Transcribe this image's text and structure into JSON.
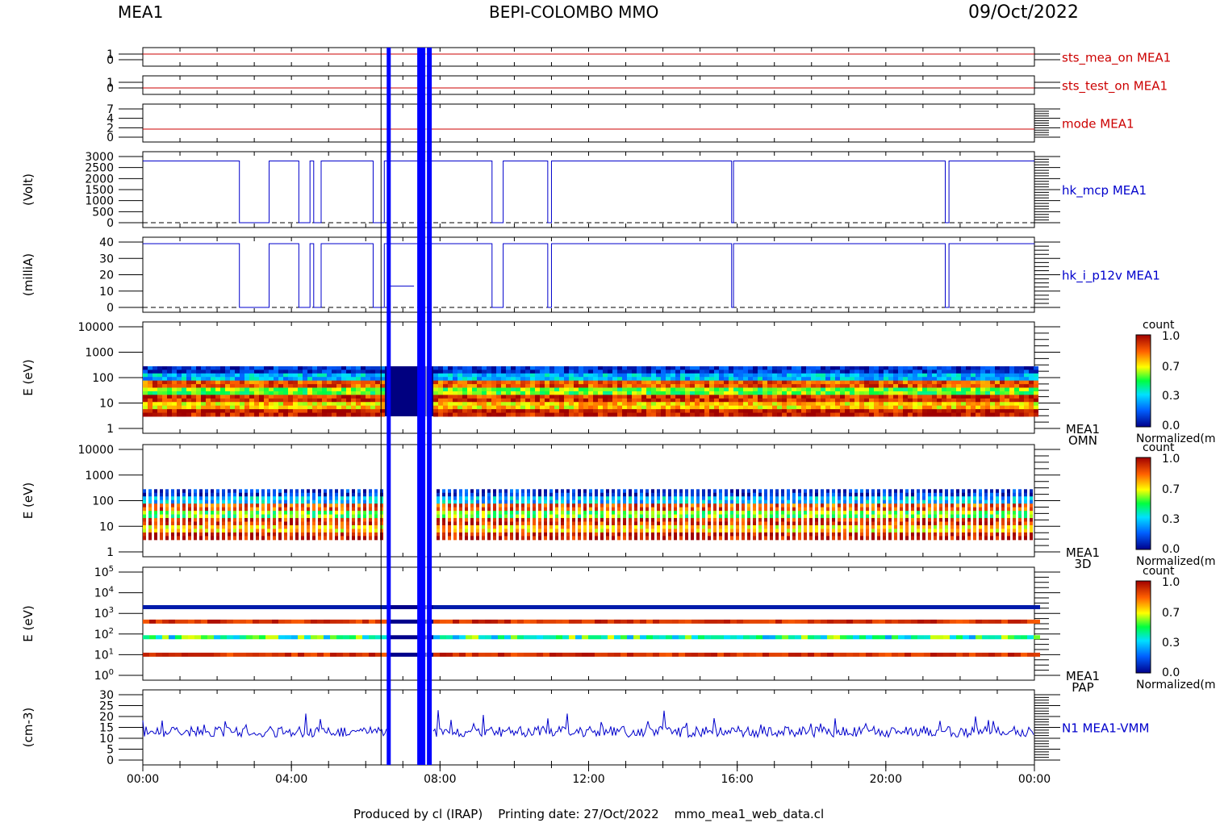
{
  "header": {
    "instrument": "MEA1",
    "mission": "BEPI-COLOMBO MMO",
    "date": "09/Oct/2022"
  },
  "footer": {
    "text": "Produced by cl (IRAP)    Printing date: 27/Oct/2022    mmo_mea1_web_data.cl"
  },
  "colors": {
    "status": "#cc0000",
    "housekeeping": "#0000cc",
    "axis": "#000000",
    "band": "#0000ff"
  },
  "colorbar": {
    "title": "count",
    "ticks": [
      "1.0",
      "0.7",
      "0.3",
      "0.0"
    ],
    "norm_label": "Normalized(m"
  },
  "chart_data": {
    "type": "line",
    "x_ticks": [
      "00:00",
      "04:00",
      "08:00",
      "12:00",
      "16:00",
      "20:00",
      "00:00"
    ],
    "x_range_hours": [
      0,
      24
    ],
    "data_gap_hours": [
      [
        6.5,
        6.6
      ],
      [
        7.3,
        7.8
      ]
    ],
    "panels": [
      {
        "id": "sts_mea_on",
        "label": "sts_mea_on MEA1",
        "yticks": [
          "1",
          "0"
        ],
        "ylim": [
          0,
          1
        ],
        "series": [
          {
            "x": [
              0,
              24
            ],
            "y": [
              1,
              1
            ]
          }
        ]
      },
      {
        "id": "sts_test_on",
        "label": "sts_test_on MEA1",
        "yticks": [
          "1",
          "0"
        ],
        "ylim": [
          0,
          1
        ],
        "series": [
          {
            "x": [
              0,
              24
            ],
            "y": [
              0,
              0
            ]
          }
        ]
      },
      {
        "id": "mode",
        "label": "mode MEA1",
        "yticks": [
          "7",
          "4",
          "2",
          "0"
        ],
        "ylim": [
          0,
          7
        ],
        "series": [
          {
            "x": [
              0,
              24
            ],
            "y": [
              2,
              2
            ]
          }
        ]
      },
      {
        "id": "hk_mcp",
        "label": "hk_mcp MEA1",
        "ylabel": "(Volt)",
        "yticks": [
          "3000",
          "2500",
          "2000",
          "1500",
          "1000",
          "500",
          "0"
        ],
        "ylim": [
          0,
          3000
        ],
        "baseline_level": 2800,
        "drops_to": 0,
        "drop_intervals_hours": [
          [
            2.6,
            3.4
          ],
          [
            4.2,
            4.5
          ],
          [
            4.6,
            4.8
          ],
          [
            6.2,
            6.5
          ],
          [
            9.4,
            9.7
          ],
          [
            10.9,
            11.0
          ],
          [
            15.85,
            15.9
          ],
          [
            21.6,
            21.7
          ]
        ]
      },
      {
        "id": "hk_i_p12v",
        "label": "hk_i_p12v MEA1",
        "ylabel": "(milliA)",
        "yticks": [
          "40",
          "30",
          "20",
          "10",
          "0"
        ],
        "ylim": [
          0,
          40
        ],
        "baseline_level": 39,
        "drops_to": 0,
        "drop_intervals_hours": [
          [
            2.6,
            3.4
          ],
          [
            4.2,
            4.5
          ],
          [
            4.6,
            4.8
          ],
          [
            6.2,
            6.5
          ],
          [
            9.4,
            9.7
          ],
          [
            10.9,
            11.0
          ],
          [
            15.85,
            15.9
          ],
          [
            21.6,
            21.7
          ]
        ],
        "gap_level": 13
      },
      {
        "id": "omn",
        "type": "heatmap",
        "label": [
          "MEA1",
          "OMN"
        ],
        "ylabel": "E (eV)",
        "yticks": [
          "10000",
          "1000",
          "100",
          "10",
          "1"
        ],
        "yscale": "log",
        "ylim": [
          1,
          10000
        ],
        "energy_range_eV": [
          3,
          280
        ],
        "colorbar": [
          0.0,
          1.0
        ]
      },
      {
        "id": "3d",
        "type": "heatmap",
        "label": [
          "MEA1",
          "3D"
        ],
        "ylabel": "E (eV)",
        "yticks": [
          "10000",
          "1000",
          "100",
          "10",
          "1"
        ],
        "yscale": "log",
        "ylim": [
          1,
          10000
        ],
        "energy_range_eV": [
          3,
          280
        ],
        "colorbar": [
          0.0,
          1.0
        ]
      },
      {
        "id": "pap",
        "type": "heatmap",
        "label": [
          "MEA1",
          "PAP"
        ],
        "ylabel": "E (eV)",
        "yticks": [
          "10^5",
          "10^4",
          "10^3",
          "10^2",
          "10^1",
          "10^0"
        ],
        "yscale": "log",
        "ylim": [
          1,
          100000
        ],
        "bands_eV": [
          2000,
          400,
          70,
          10
        ],
        "colorbar": [
          0.0,
          1.0
        ]
      },
      {
        "id": "n1",
        "label": "N1 MEA1-VMM",
        "ylabel": "(cm-3)",
        "yticks": [
          "30",
          "25",
          "20",
          "15",
          "10",
          "5",
          "0"
        ],
        "ylim": [
          0,
          30
        ],
        "mean_level": 13
      }
    ]
  }
}
